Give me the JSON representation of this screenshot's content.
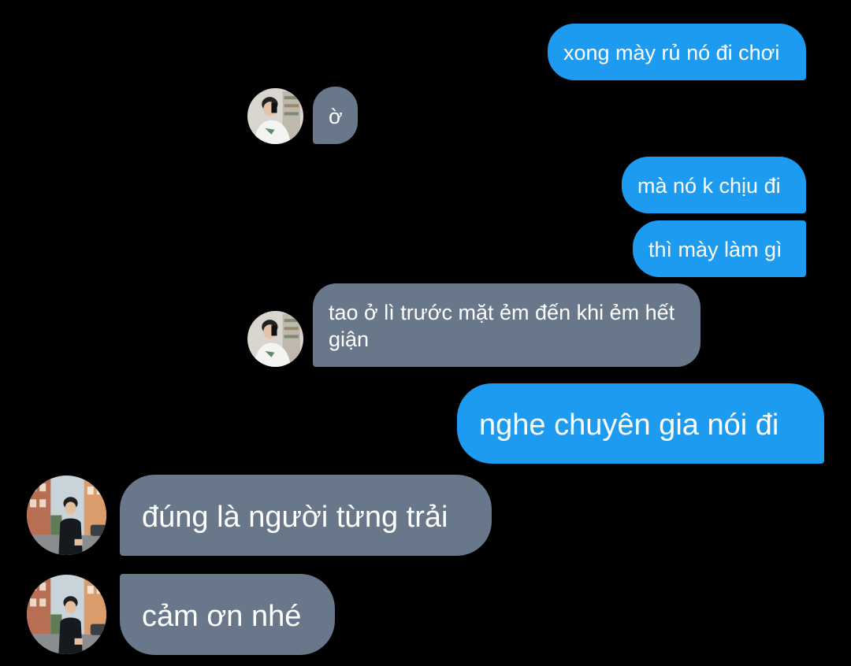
{
  "messages": [
    {
      "id": "m1",
      "direction": "sent",
      "text": "xong mày rủ nó đi chơi"
    },
    {
      "id": "m2",
      "direction": "received",
      "text": "ờ"
    },
    {
      "id": "m3",
      "direction": "sent",
      "text": "mà nó k chịu đi"
    },
    {
      "id": "m4",
      "direction": "sent",
      "text": "thì mày làm gì"
    },
    {
      "id": "m5",
      "direction": "received",
      "text": "tao ở lì trước mặt ẻm đến khi ẻm hết giận"
    },
    {
      "id": "m6",
      "direction": "sent",
      "text": "nghe chuyên gia nói đi"
    },
    {
      "id": "m7",
      "direction": "received",
      "text": "đúng là người từng trải"
    },
    {
      "id": "m8",
      "direction": "received",
      "text": "cảm ơn nhé"
    }
  ],
  "colors": {
    "background": "#000000",
    "sent_bubble": "#1d9bf0",
    "received_bubble": "#68778a",
    "text": "#ffffff"
  },
  "avatars": {
    "contact_a": "avatar-mirror-selfie-photo",
    "contact_b": "avatar-street-photo"
  }
}
